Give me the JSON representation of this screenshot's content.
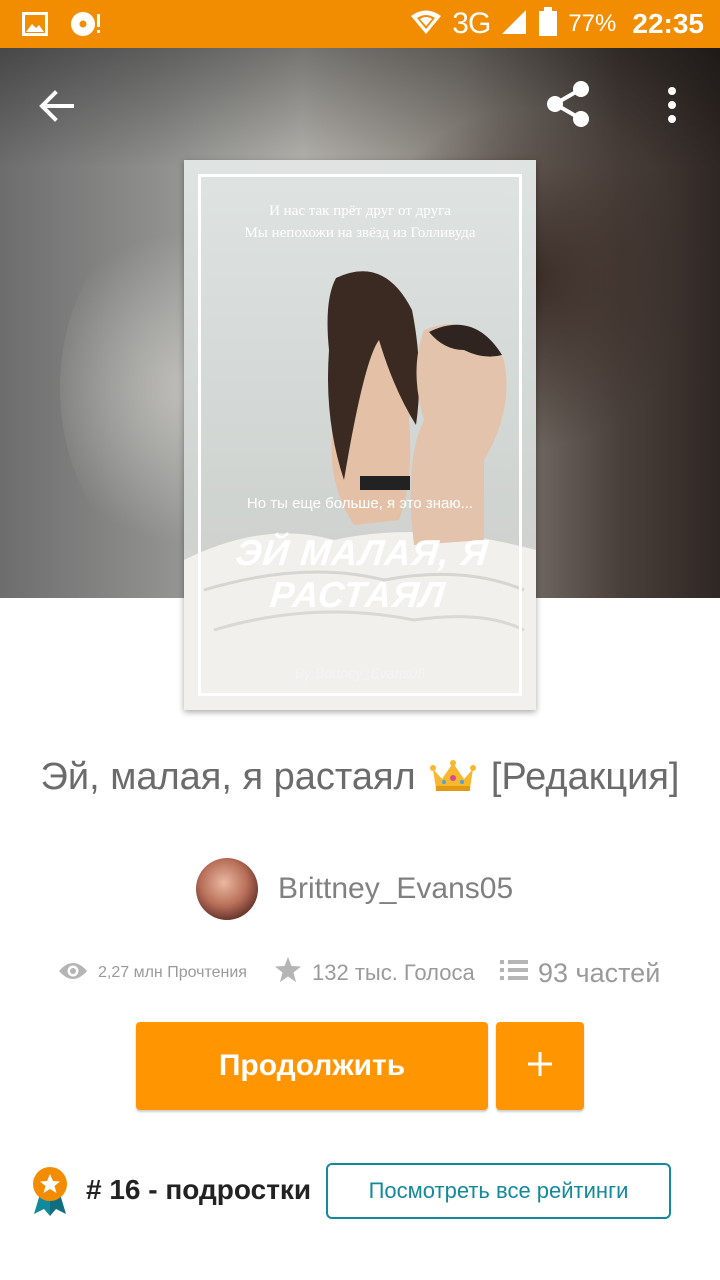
{
  "status_bar": {
    "network": "3G",
    "battery": "77%",
    "time": "22:35",
    "icons": [
      "image-icon",
      "media-icon",
      "wifi-icon",
      "signal-icon",
      "battery-icon"
    ]
  },
  "toolbar": {
    "icons": [
      "back-arrow-icon",
      "share-icon",
      "more-vertical-icon"
    ]
  },
  "cover": {
    "top_line1": "И нас так прёт друг от друга",
    "top_line2": "Мы непохожи на звёзд из Голливуда",
    "mid_text": "Но ты еще больше, я это знаю...",
    "title_art": "ЭЙ МАЛАЯ, Я РАСТАЯЛ",
    "byline": "By Brittney_Evans05"
  },
  "story": {
    "title_pre": "Эй, малая, я растаял",
    "title_post": "[Редакция]",
    "author": "Brittney_Evans05"
  },
  "stats": {
    "reads": "2,27 млн Прочтения",
    "votes": "132 тыс. Голоса",
    "parts": "93 частей"
  },
  "actions": {
    "continue_label": "Продолжить",
    "add_label": "+"
  },
  "ranking": {
    "text": "# 16 - подростки",
    "view_all_label": "Посмотреть все рейтинги"
  },
  "colors": {
    "status_bar": "#f28c00",
    "accent": "#ff9500",
    "teal": "#13899c"
  }
}
